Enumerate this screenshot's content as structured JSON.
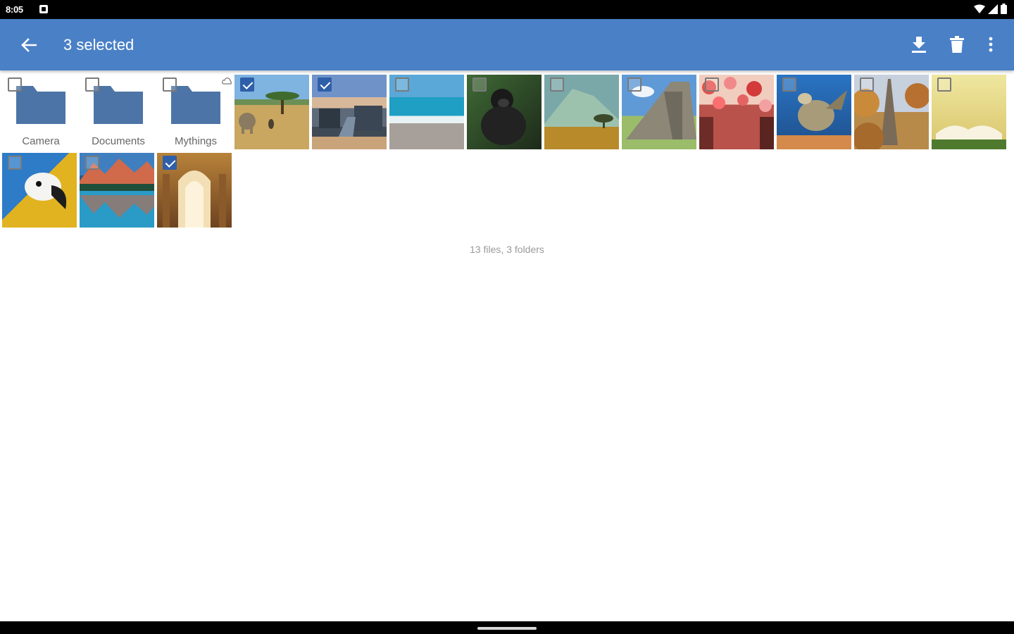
{
  "status_bar": {
    "time": "8:05",
    "icons": [
      "notification-icon",
      "wifi-icon",
      "signal-icon",
      "battery-icon"
    ]
  },
  "app_bar": {
    "title": "3 selected",
    "background": "#4a80c6",
    "actions": [
      "back-arrow-icon",
      "download-icon",
      "delete-icon",
      "more-vert-icon"
    ]
  },
  "folders": [
    {
      "name": "Camera",
      "checked": false
    },
    {
      "name": "Documents",
      "checked": false
    },
    {
      "name": "Mythings",
      "checked": false,
      "synced": true
    }
  ],
  "photos": [
    {
      "subject": "savanna-elephants",
      "checked": true
    },
    {
      "subject": "coastal-city",
      "checked": true
    },
    {
      "subject": "beach-waves",
      "checked": false
    },
    {
      "subject": "gorilla",
      "checked": false
    },
    {
      "subject": "mountain-plain",
      "checked": false
    },
    {
      "subject": "pyramid",
      "checked": false
    },
    {
      "subject": "street-umbrellas",
      "checked": false
    },
    {
      "subject": "sea-turtle",
      "checked": false
    },
    {
      "subject": "eiffel-tower-autumn",
      "checked": false
    },
    {
      "subject": "open-book",
      "checked": false
    },
    {
      "subject": "macaw",
      "checked": false
    },
    {
      "subject": "mountain-lake",
      "checked": false
    },
    {
      "subject": "palace-arches",
      "checked": true
    }
  ],
  "summary": "13 files, 3 folders",
  "colors": {
    "accent": "#4a80c6",
    "folder": "#4d74a6",
    "checkbox_checked": "#2f5fa8"
  }
}
